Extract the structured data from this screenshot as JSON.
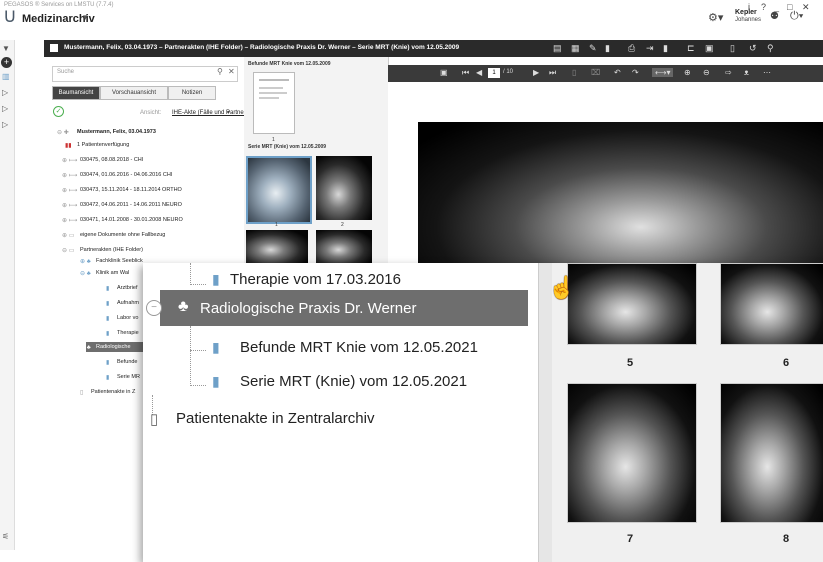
{
  "app": {
    "title": "PEGASOS ® Services on LMSTU (7.7.4)",
    "module": "Medizinarchiv",
    "window_controls": [
      "i",
      "?",
      "_",
      "□",
      "✕"
    ],
    "user_name": "Kepler",
    "user_sub": "Johannes"
  },
  "header": {
    "breadcrumb": "Mustermann, Felix, 03.04.1973  –  Partnerakten (IHE Folder)  –  Radiologische Praxis Dr. Werner  –  Serie MRT (Knie) vom 12.05.2009"
  },
  "left": {
    "search_placeholder": "Suche",
    "tabs": [
      "Baumansicht",
      "Vorschauansicht",
      "Notizen"
    ],
    "ansicht_label": "Ansicht:",
    "ansicht_value": "IHE-Akte (Fälle und Partner)",
    "tree": [
      "Mustermann, Felix, 03.04.1973",
      "1 Patientenverfügung",
      "030475, 08.08.2018 -  CHI",
      "030474, 01.06.2016 - 04.06.2016 CHI",
      "030473, 15.11.2014 - 18.11.2014 ORTHO",
      "030472, 04.06.2011 - 14.06.2011 NEURO",
      "030471, 14.01.2008 - 30.01.2008 NEURO",
      "eigene Dokumente ohne Fallbezug",
      "Partnerakten (IHE Folder)",
      "Fachklinik Seeblick",
      "Klinik am Wal",
      "Arztbrief",
      "Aufnahm",
      "Labor vo",
      "Therapie",
      "Radiologische",
      "Befunde",
      "Serie MR",
      "Patientenakte in Z"
    ]
  },
  "thumbs": {
    "group1": "Befunde MRT Knie vom 12.05.2009",
    "group2": "Serie MRT (Knie) vom 12.05.2009",
    "labels": [
      "1",
      "1",
      "2"
    ]
  },
  "viewer": {
    "page": "1",
    "page_total": "/ 10"
  },
  "zoom": {
    "items": [
      "Therapie vom 17.03.2016",
      "Radiologische Praxis Dr. Werner",
      "Befunde MRT Knie vom 12.05.2021",
      "Serie MRT (Knie) vom 12.05.2021",
      "Patientenakte in Zentralarchiv"
    ],
    "thumb_numbers": [
      "5",
      "6",
      "7",
      "8"
    ]
  }
}
